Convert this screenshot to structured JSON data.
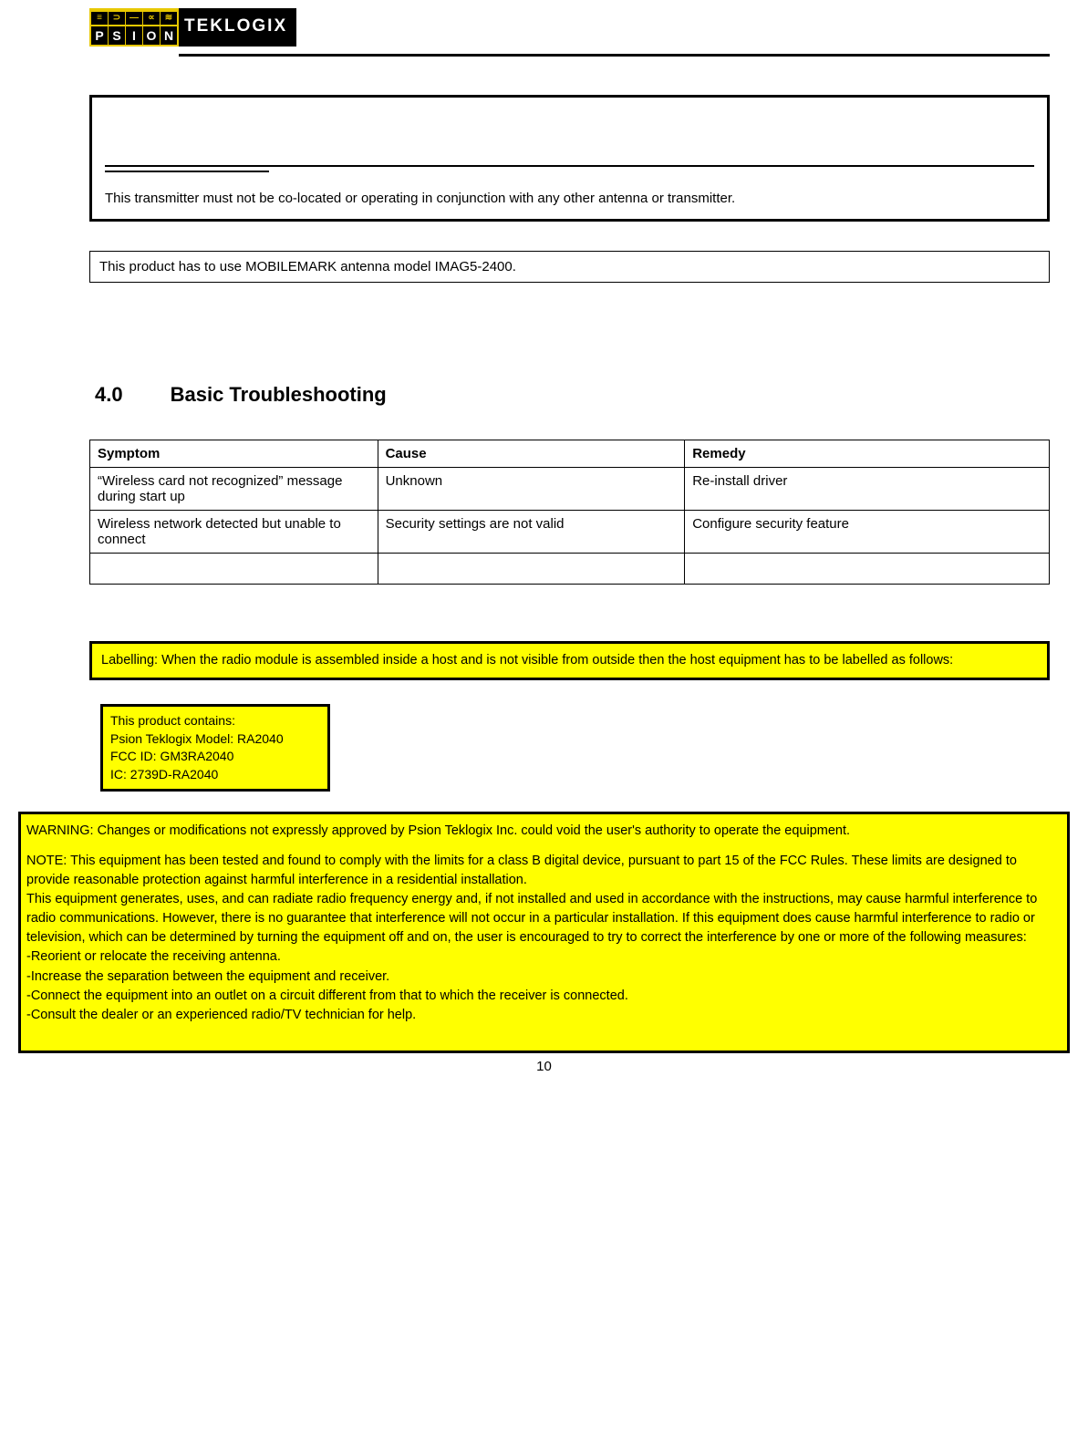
{
  "logo": {
    "brand_left_letters": [
      "P",
      "S",
      "I",
      "O",
      "N"
    ],
    "brand_right": "TEKLOGIX"
  },
  "transmitter_box": {
    "text": "This transmitter must not be co-located or operating in conjunction with any other antenna or transmitter."
  },
  "antenna_box": {
    "text": "This product has to use MOBILEMARK antenna model IMAG5-2400."
  },
  "section": {
    "number": "4.0",
    "title": "Basic Troubleshooting"
  },
  "table": {
    "headers": {
      "symptom": "Symptom",
      "cause": "Cause",
      "remedy": "Remedy"
    },
    "rows": [
      {
        "symptom": "“Wireless card not recognized” message during start up",
        "cause": "Unknown",
        "remedy": "Re-install driver"
      },
      {
        "symptom": "Wireless network detected but unable to connect",
        "cause": "Security settings are not valid",
        "remedy": "Configure security feature"
      },
      {
        "symptom": "",
        "cause": "",
        "remedy": ""
      }
    ]
  },
  "labelling": {
    "text": "Labelling: When the radio module is assembled inside a host and is not visible from outside then the host equipment has to be labelled as follows:"
  },
  "product_contains": {
    "l1": "This product contains:",
    "l2": "Psion Teklogix Model: RA2040",
    "l3": "FCC ID: GM3RA2040",
    "l4": "IC: 2739D-RA2040"
  },
  "warning": {
    "warn": "WARNING: Changes or modifications not expressly approved by Psion Teklogix Inc. could void the user's authority to operate the equipment.",
    "note_p1": "NOTE: This equipment has been tested and found to comply with the limits for a class B digital device, pursuant to part 15 of the FCC Rules. These limits are designed to provide reasonable protection against harmful interference in a residential installation.",
    "note_p2": "This equipment generates, uses, and can radiate radio frequency energy and, if not installed and used in accordance with the instructions, may cause harmful interference to radio communications. However, there is no guarantee that interference will not occur in a particular installation. If this equipment does cause harmful interference to radio or television, which can be determined by turning the equipment off and on, the user is encouraged to try to correct the interference by one or more of the following measures:",
    "m1": "-Reorient or relocate the receiving antenna.",
    "m2": "-Increase the separation between the equipment and receiver.",
    "m3": "-Connect the equipment into an outlet on a circuit different from that to which the receiver is connected.",
    "m4": "-Consult the dealer or an experienced radio/TV technician for help."
  },
  "page_number": "10"
}
